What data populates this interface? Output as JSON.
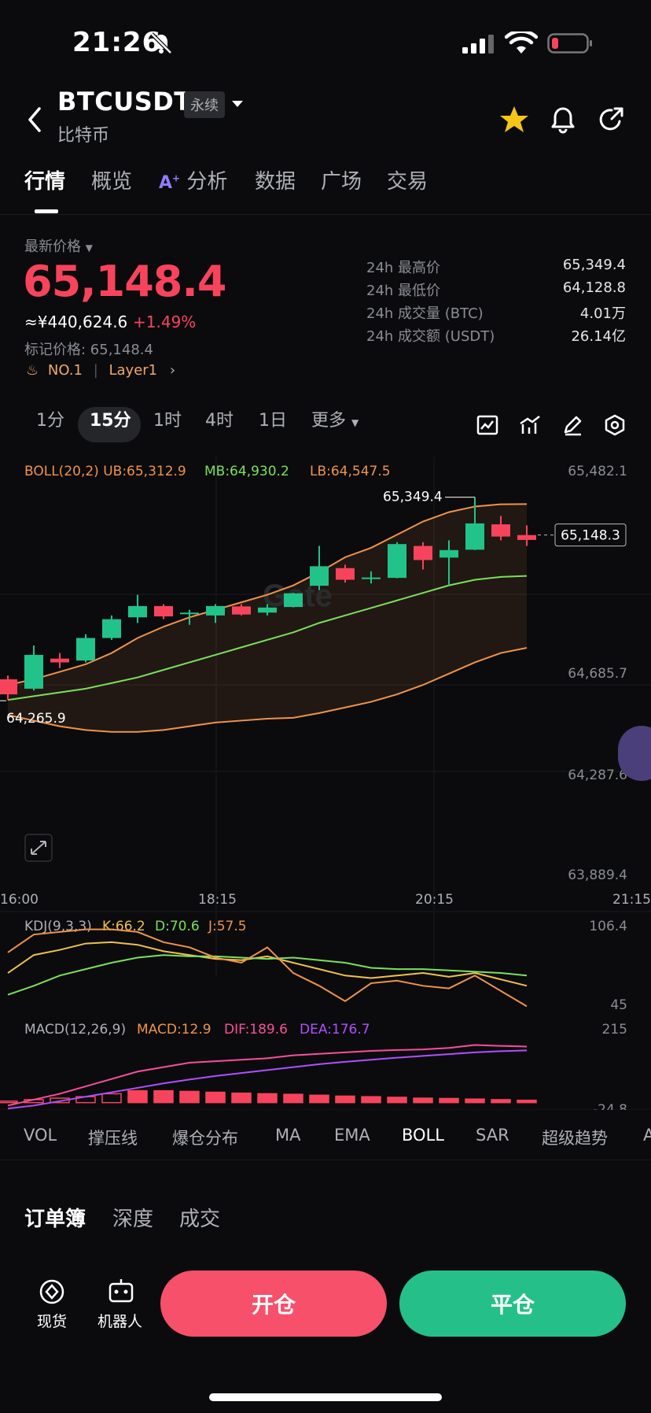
{
  "status": {
    "time": "21:26"
  },
  "header": {
    "symbol": "BTCUSDT",
    "contract_type": "永续",
    "name": "比特币"
  },
  "tabs": [
    "行情",
    "概览",
    "分析",
    "数据",
    "广场",
    "交易"
  ],
  "ticker": {
    "price_label": "最新价格",
    "last_price": "65,148.4",
    "cny_price": "≈¥440,624.6",
    "change_pct": "+1.49%",
    "mark_price": "标记价格: 65,148.4",
    "rank": "NO.1",
    "category": "Layer1",
    "stats": [
      {
        "label": "24h 最高价",
        "value": "65,349.4"
      },
      {
        "label": "24h 最低价",
        "value": "64,128.8"
      },
      {
        "label": "24h 成交量 (BTC)",
        "value": "4.01万"
      },
      {
        "label": "24h 成交额 (USDT)",
        "value": "26.14亿"
      }
    ]
  },
  "timeframes": [
    "1分",
    "15分",
    "1时",
    "4时",
    "1日",
    "更多"
  ],
  "chart_data": {
    "type": "candlestick",
    "boll_header": {
      "name": "BOLL(20,2)",
      "ub": "UB:65,312.9",
      "mb": "MB:64,930.2",
      "lb": "LB:64,547.5"
    },
    "y_ticks": [
      "65,482.1",
      "64,685.7",
      "64,287.6",
      "63,889.4"
    ],
    "x_ticks": [
      "16:00",
      "18:15",
      "20:15",
      "21:15"
    ],
    "high_label": "65,349.4",
    "low_label": "64,265.9",
    "current_label": "65,148.3",
    "candles": [
      {
        "o": 64380,
        "c": 64300,
        "h": 64400,
        "l": 64270
      },
      {
        "o": 64330,
        "c": 64510,
        "h": 64560,
        "l": 64320
      },
      {
        "o": 64490,
        "c": 64470,
        "h": 64520,
        "l": 64440
      },
      {
        "o": 64480,
        "c": 64600,
        "h": 64620,
        "l": 64470
      },
      {
        "o": 64600,
        "c": 64700,
        "h": 64720,
        "l": 64590
      },
      {
        "o": 64710,
        "c": 64770,
        "h": 64830,
        "l": 64680
      },
      {
        "o": 64770,
        "c": 64715,
        "h": 64780,
        "l": 64700
      },
      {
        "o": 64735,
        "c": 64735,
        "h": 64750,
        "l": 64670
      },
      {
        "o": 64720,
        "c": 64770,
        "h": 64780,
        "l": 64680
      },
      {
        "o": 64768,
        "c": 64725,
        "h": 64780,
        "l": 64720
      },
      {
        "o": 64735,
        "c": 64762,
        "h": 64780,
        "l": 64720
      },
      {
        "o": 64765,
        "c": 64838,
        "h": 64840,
        "l": 64763
      },
      {
        "o": 64878,
        "c": 64982,
        "h": 65090,
        "l": 64855
      },
      {
        "o": 64972,
        "c": 64910,
        "h": 64990,
        "l": 64895
      },
      {
        "o": 64915,
        "c": 64922,
        "h": 64955,
        "l": 64890
      },
      {
        "o": 64920,
        "c": 65100,
        "h": 65110,
        "l": 64918
      },
      {
        "o": 65090,
        "c": 65015,
        "h": 65110,
        "l": 64965
      },
      {
        "o": 65028,
        "c": 65068,
        "h": 65120,
        "l": 64880
      },
      {
        "o": 65070,
        "c": 65210,
        "h": 65349.4,
        "l": 65068
      },
      {
        "o": 65205,
        "c": 65140,
        "h": 65250,
        "l": 65120
      },
      {
        "o": 65148,
        "c": 65122,
        "h": 65200,
        "l": 65090
      }
    ],
    "ub": [
      64350,
      64380,
      64420,
      64460,
      64520,
      64600,
      64660,
      64710,
      64750,
      64790,
      64830,
      64880,
      64950,
      65030,
      65080,
      65150,
      65220,
      65270,
      65300,
      65312,
      65312.9
    ],
    "mb": [
      64270,
      64290,
      64310,
      64330,
      64360,
      64390,
      64430,
      64470,
      64510,
      64550,
      64590,
      64630,
      64680,
      64720,
      64760,
      64800,
      64840,
      64880,
      64910,
      64925,
      64930.2
    ],
    "lb": [
      64190,
      64160,
      64130,
      64110,
      64100,
      64100,
      64110,
      64130,
      64150,
      64160,
      64170,
      64175,
      64200,
      64230,
      64260,
      64300,
      64350,
      64410,
      64470,
      64520,
      64547.5
    ],
    "kdj_header": {
      "name": "KDJ(9,3,3)",
      "k": "K:66.2",
      "d": "D:70.6",
      "j": "J:57.5"
    },
    "kdj_ticks": [
      "106.4",
      "45"
    ],
    "k": [
      72,
      86,
      90,
      95,
      96,
      94,
      89,
      86,
      83,
      82,
      85,
      80,
      75,
      70,
      68,
      70,
      72,
      69,
      72,
      67,
      62
    ],
    "d": [
      55,
      62,
      70,
      75,
      80,
      84,
      86,
      85,
      85,
      84,
      83,
      84,
      82,
      80,
      76,
      75,
      75,
      74,
      73,
      72,
      70
    ],
    "j": [
      88,
      102,
      104,
      106,
      106,
      104,
      96,
      92,
      84,
      80,
      92,
      72,
      62,
      50,
      64,
      66,
      62,
      60,
      70,
      58,
      46
    ],
    "macd_header": {
      "name": "MACD(12,26,9)",
      "macd": "MACD:12.9",
      "dif": "DIF:189.6",
      "dea": "DEA:176.7"
    },
    "macd_ticks": [
      "215",
      "-24.8"
    ],
    "dif": [
      -10,
      10,
      30,
      55,
      80,
      105,
      120,
      135,
      140,
      145,
      150,
      160,
      165,
      170,
      175,
      178,
      180,
      185,
      195,
      192,
      189.6
    ],
    "dea": [
      -20,
      -10,
      5,
      20,
      35,
      50,
      65,
      78,
      90,
      100,
      110,
      120,
      130,
      138,
      145,
      152,
      158,
      164,
      170,
      174,
      176.7
    ],
    "hist": [
      5,
      10,
      15,
      20,
      30,
      40,
      40,
      38,
      35,
      32,
      30,
      28,
      25,
      22,
      20,
      18,
      15,
      14,
      12,
      10,
      8
    ]
  },
  "indicators": [
    "VOL",
    "撑压线",
    "爆仓分布",
    "MA",
    "EMA",
    "BOLL",
    "SAR",
    "超级趋势",
    "A"
  ],
  "orderbook_tabs": [
    "订单簿",
    "深度",
    "成交"
  ],
  "bottom": {
    "spot": "现货",
    "bot": "机器人",
    "open": "开仓",
    "close": "平仓"
  },
  "colors": {
    "up": "#22c38b",
    "down": "#f7445c",
    "ub": "#f0934a",
    "mb": "#7be05a",
    "lb": "#f0934a"
  }
}
